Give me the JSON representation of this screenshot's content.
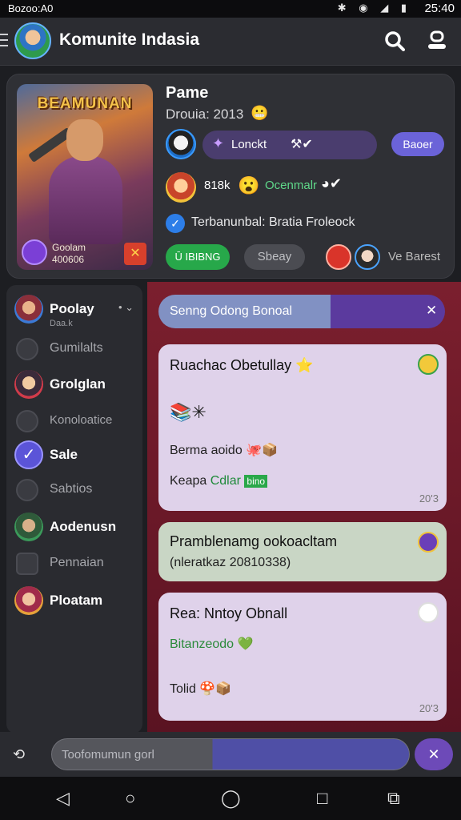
{
  "status_bar": {
    "carrier": "Bozoo:A0",
    "time": "25:40",
    "icons": "✱ ◉ ◢ ▮"
  },
  "header": {
    "title": "Komunite Indasia"
  },
  "profile": {
    "cover_title": "BEAMUNAN",
    "cover_caption_1": "Goolam",
    "cover_caption_2": "400606",
    "name": "Pame",
    "subtitle": "Drouia: 2013",
    "subtitle_emoji": "😬",
    "tag_text": "Lonckt",
    "tag_icons": "⚒✔",
    "action_button": "Baoer",
    "count": "818k",
    "count_emoji": "😮",
    "link_text": "Ocenmalr",
    "link_icons": "◕✔",
    "verified_text": "Terbanunbal: Bratia Froleock",
    "follow_button": "Ū IBIBNG",
    "share_button": "Sbeay",
    "friend_text": "Ve Barest"
  },
  "sidebar": {
    "items": [
      {
        "label": "Poolay",
        "sub": "Daa.k"
      },
      {
        "label": "Gumilalts"
      },
      {
        "label": "Grolglan"
      },
      {
        "label": "Konoloatice"
      },
      {
        "label": "Sale"
      },
      {
        "label": "Sabtios"
      },
      {
        "label": "Aodenusn"
      },
      {
        "label": "Pennaian"
      },
      {
        "label": "Ploatam"
      }
    ]
  },
  "chat": {
    "banner": "Senng Odong Bonoal",
    "messages": [
      {
        "title": "Ruachac Obetullay",
        "title_emoji": "⭐",
        "line1": "📚✳",
        "line2": "Berma aoido",
        "line2_emoji": "🐙📦",
        "line3_a": "Keapa",
        "line3_b": "Cdlar",
        "line3_c": "bino",
        "time": "20'3"
      },
      {
        "title": "Pramblenamg ookoacltam",
        "line1": "(nleratkaz 20810338)"
      },
      {
        "title": "Rea: Nntoy Obnall",
        "line1": "Bitanzeodo",
        "line1_emoji": "💚",
        "line2": "Tolid",
        "line2_emoji": "🍄📦",
        "time": "20'3"
      }
    ]
  },
  "input": {
    "placeholder": "Toofomumun gorl"
  },
  "nav": {
    "back": "◁",
    "home_alt": "○",
    "home": "◯",
    "recents": "□",
    "extra": "⧉"
  }
}
